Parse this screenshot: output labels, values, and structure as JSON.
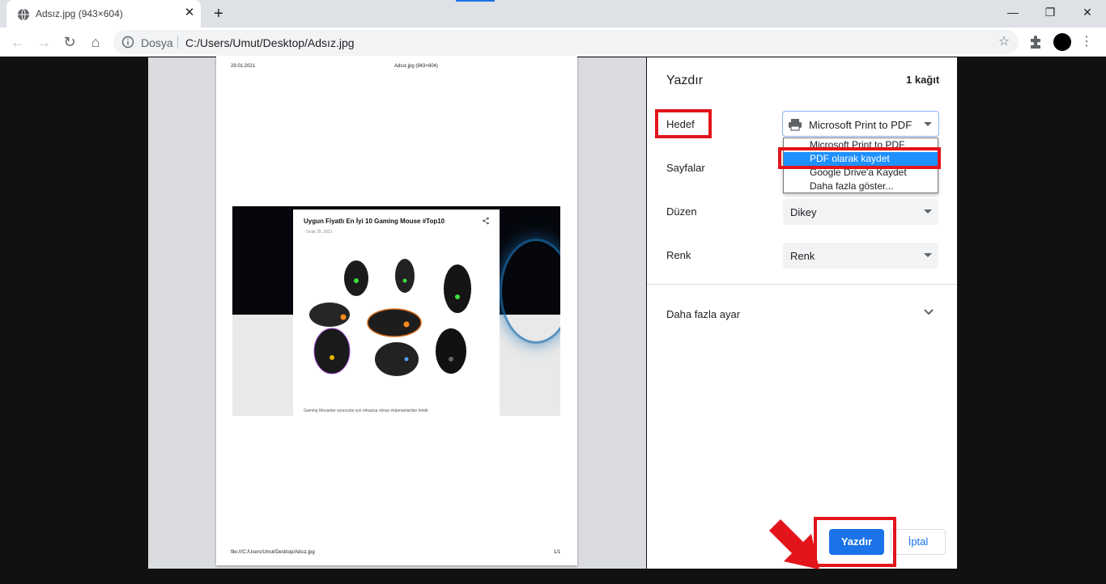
{
  "browser": {
    "tab_title": "Adsız.jpg (943×604)",
    "tab_close": "✕",
    "new_tab": "+",
    "window_controls": {
      "minimize": "—",
      "restore": "❐",
      "close": "✕"
    },
    "address": {
      "scheme_label": "Dosya",
      "url": "C:/Users/Umut/Desktop/Adsız.jpg"
    },
    "nav": {
      "back": "←",
      "forward": "→",
      "reload": "↻",
      "home": "⌂"
    },
    "star": "☆",
    "menu": "⋮"
  },
  "page_preview": {
    "header_date": "29.01.2021",
    "header_title": "Adsız.jpg (943×604)",
    "footer_path": "file:///C:/Users/Umut/Desktop/Adsız.jpg",
    "footer_page": "1/1",
    "image": {
      "article_title": "Uygun Fiyatlı En İyi 10 Gaming Mouse #Top10",
      "article_date": "- Ocak 25, 2021",
      "caption": "Gaming Mouselar oyuncular için olmazsa olmaz ekipmanlardan biridir",
      "share_icon": "share-icon"
    }
  },
  "print_panel": {
    "title": "Yazdır",
    "sheet_count": "1 kağıt",
    "destination": {
      "label": "Hedef",
      "value": "Microsoft Print to PDF",
      "options": [
        "Microsoft Print to PDF",
        "PDF olarak kaydet",
        "Google Drive'a Kaydet",
        "Daha fazla göster..."
      ],
      "highlighted_option": "PDF olarak kaydet"
    },
    "pages": {
      "label": "Sayfalar"
    },
    "layout": {
      "label": "Düzen",
      "value": "Dikey"
    },
    "color": {
      "label": "Renk",
      "value": "Renk"
    },
    "more_settings": "Daha fazla ayar",
    "print_button": "Yazdır",
    "cancel_button": "İptal"
  },
  "colors": {
    "accent": "#1a73e8",
    "annotation_red": "#e3141b",
    "dropdown_selected": "#1e90ff"
  }
}
